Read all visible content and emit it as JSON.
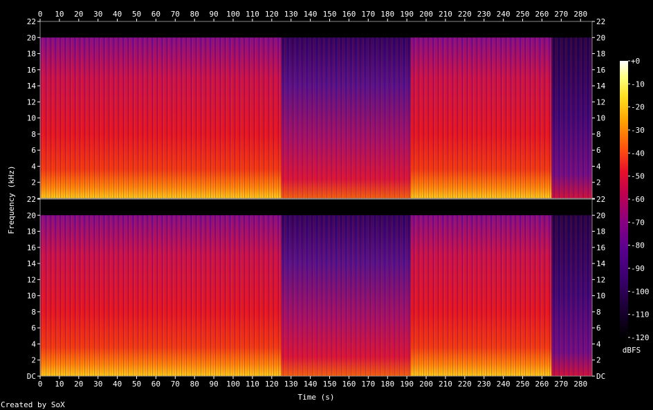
{
  "chart_data": {
    "type": "heatmap",
    "title": "",
    "xlabel": "Time (s)",
    "ylabel": "Frequency (kHz)",
    "x_unit": "s",
    "xlim": [
      0,
      286
    ],
    "x_ticks": [
      0,
      10,
      20,
      30,
      40,
      50,
      60,
      70,
      80,
      90,
      100,
      110,
      120,
      130,
      140,
      150,
      160,
      170,
      180,
      190,
      200,
      210,
      220,
      230,
      240,
      250,
      260,
      270,
      280
    ],
    "ylim": [
      0,
      22
    ],
    "y_tick_labels": [
      "DC",
      "2",
      "4",
      "6",
      "8",
      "10",
      "12",
      "14",
      "16",
      "18",
      "20",
      "22"
    ],
    "y_tick_values": [
      0,
      2,
      4,
      6,
      8,
      10,
      12,
      14,
      16,
      18,
      20,
      22
    ],
    "channels": 2,
    "content_cutoff_khz": 20,
    "colorbar": {
      "label": "dBFS",
      "range": [
        -120,
        0
      ],
      "tick_labels": [
        "+0",
        "-10",
        "-20",
        "-30",
        "-40",
        "-50",
        "-60",
        "-70",
        "-80",
        "-90",
        "-100",
        "-110",
        "-120"
      ],
      "tick_values": [
        0,
        -10,
        -20,
        -30,
        -40,
        -50,
        -60,
        -70,
        -80,
        -90,
        -100,
        -110,
        -120
      ]
    },
    "segments": [
      {
        "start": 0,
        "end": 125,
        "level": "loud"
      },
      {
        "start": 125,
        "end": 192,
        "level": "quieter"
      },
      {
        "start": 192,
        "end": 265,
        "level": "loud"
      },
      {
        "start": 265,
        "end": 286,
        "level": "fade-out"
      }
    ],
    "colormap": [
      "#000000",
      "#1a0033",
      "#3c0070",
      "#5a0090",
      "#8a0080",
      "#c00050",
      "#e8102a",
      "#ff5010",
      "#ffa000",
      "#ffe020",
      "#ffff80",
      "#ffffff"
    ]
  },
  "footer": {
    "created_by": "Created by SoX"
  }
}
